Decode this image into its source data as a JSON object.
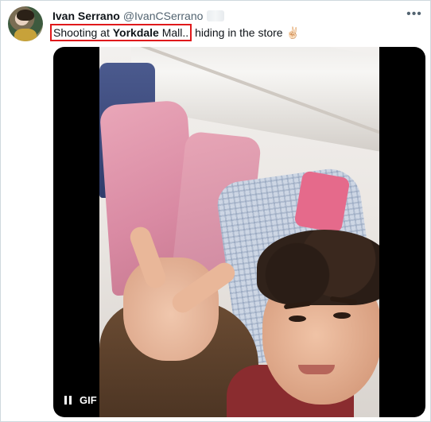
{
  "tweet": {
    "display_name": "Ivan Serrano",
    "handle": "@IvanCSerrano",
    "more_icon": "more-horizontal-icon",
    "text_highlighted_prefix": "Shooting at ",
    "text_highlighted_bold": "Yorkdale",
    "text_highlighted_suffix": " Mall..",
    "text_rest": " hiding in the store ✌🏻",
    "highlight_color": "#e0191b"
  },
  "media": {
    "badge_label": "GIF",
    "pause_icon": "pause-icon"
  }
}
